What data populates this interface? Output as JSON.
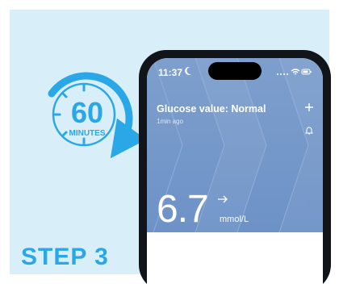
{
  "timer": {
    "number": "60",
    "label": "MINUTES"
  },
  "step_label": "STEP 3",
  "status_bar": {
    "time": "11:37"
  },
  "reading": {
    "title": "Glucose value: Normal",
    "subtitle": "1min ago",
    "value": "6.7",
    "unit": "mmol/L"
  },
  "icons": [
    "moon-icon",
    "signal-icon",
    "wifi-icon",
    "battery-icon",
    "plus-icon",
    "bell-icon",
    "arrow-right-icon",
    "timer-arrow-icon"
  ],
  "colors": {
    "accent": "#2aa7e6",
    "panel": "#d8eef9",
    "card": "#7393c8"
  }
}
